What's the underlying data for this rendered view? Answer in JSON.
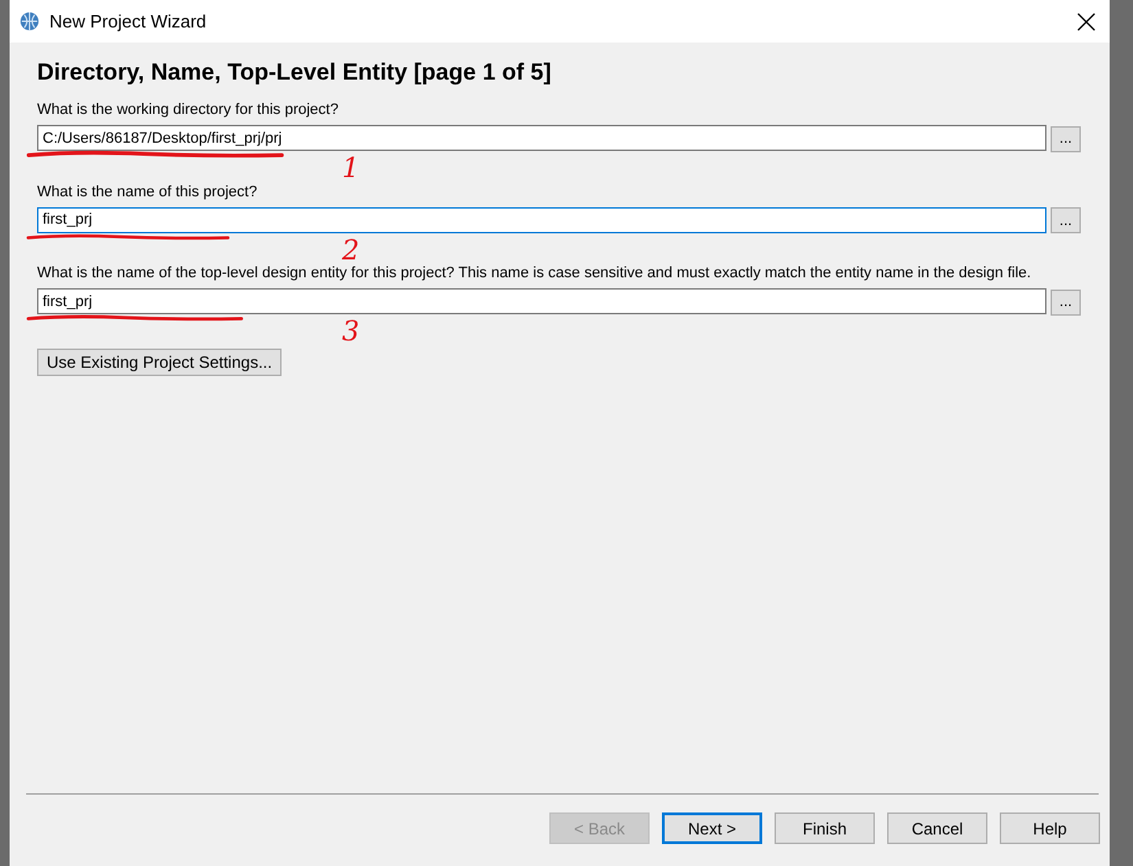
{
  "window": {
    "title": "New Project Wizard"
  },
  "heading": "Directory, Name, Top-Level Entity [page 1 of 5]",
  "fields": [
    {
      "label": "What is the working directory for this project?",
      "value": "C:/Users/86187/Desktop/first_prj/prj",
      "browse": "...",
      "focused": false,
      "annotation": "1"
    },
    {
      "label": "What is the name of this project?",
      "value": "first_prj",
      "browse": "...",
      "focused": true,
      "annotation": "2"
    },
    {
      "label": "What is the name of the top-level design entity for this project? This name is case sensitive and must exactly match the entity name in the design file.",
      "value": "first_prj",
      "browse": "...",
      "focused": false,
      "annotation": "3"
    }
  ],
  "existing_settings_button": "Use Existing Project Settings...",
  "buttons": [
    {
      "label": "< Back",
      "disabled": true,
      "default": false
    },
    {
      "label": "Next >",
      "disabled": false,
      "default": true
    },
    {
      "label": "Finish",
      "disabled": false,
      "default": false
    },
    {
      "label": "Cancel",
      "disabled": false,
      "default": false
    },
    {
      "label": "Help",
      "disabled": false,
      "default": false
    }
  ]
}
